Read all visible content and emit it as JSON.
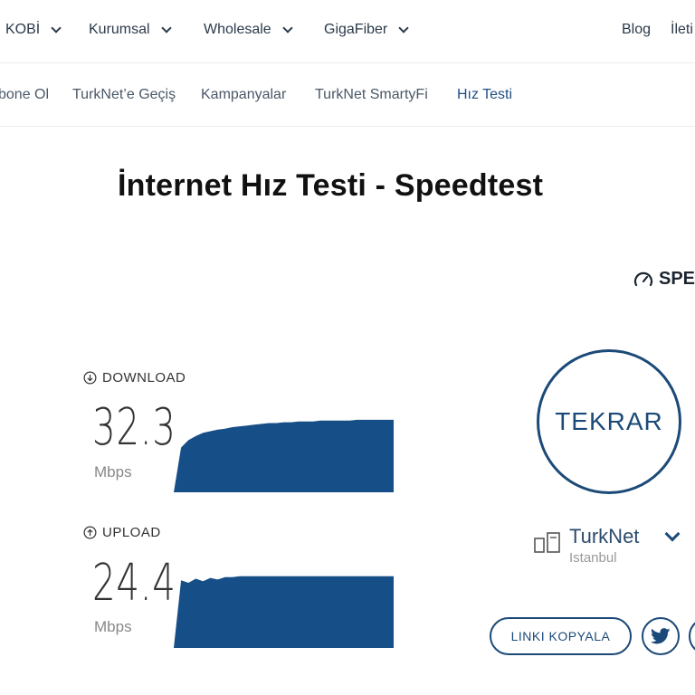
{
  "top_nav": {
    "items": [
      {
        "label": "KOBİ",
        "has_dropdown": true
      },
      {
        "label": "Kurumsal",
        "has_dropdown": true
      },
      {
        "label": "Wholesale",
        "has_dropdown": true
      },
      {
        "label": "GigaFiber",
        "has_dropdown": true
      }
    ],
    "blog": "Blog",
    "contact": "İleti"
  },
  "sub_nav": {
    "items": [
      {
        "label": "bone Ol"
      },
      {
        "label": "TurkNet’e Geçiş"
      },
      {
        "label": "Kampanyalar"
      },
      {
        "label": "TurkNet SmartyFi"
      },
      {
        "label": "Hız Testi",
        "active": true
      }
    ]
  },
  "page": {
    "title": "İnternet Hız Testi - Speedtest",
    "speedtest_label": "SPE"
  },
  "download": {
    "label": "DOWNLOAD",
    "value": "32.3",
    "unit": "Mbps",
    "graph": [
      0.0,
      0.55,
      0.64,
      0.69,
      0.73,
      0.75,
      0.77,
      0.78,
      0.8,
      0.81,
      0.82,
      0.83,
      0.84,
      0.85,
      0.85,
      0.86,
      0.86,
      0.87,
      0.87,
      0.87,
      0.88,
      0.88,
      0.88,
      0.88,
      0.88,
      0.89,
      0.89,
      0.89,
      0.89,
      0.89,
      0.89
    ]
  },
  "upload": {
    "label": "UPLOAD",
    "value": "24.4",
    "unit": "Mbps",
    "graph": [
      0.0,
      0.83,
      0.8,
      0.85,
      0.82,
      0.86,
      0.84,
      0.87,
      0.87,
      0.88,
      0.88,
      0.88,
      0.88,
      0.88,
      0.88,
      0.88,
      0.88,
      0.88,
      0.88,
      0.88,
      0.88,
      0.88,
      0.88,
      0.88,
      0.88,
      0.88,
      0.88,
      0.88,
      0.88,
      0.88,
      0.88
    ]
  },
  "actions": {
    "retest": "TEKRAR",
    "copy_link": "LINKI KOPYALA"
  },
  "provider": {
    "name": "TurkNet",
    "location": "Istanbul"
  },
  "colors": {
    "accent": "#1c4a78",
    "graph_fill": "#164e87"
  }
}
